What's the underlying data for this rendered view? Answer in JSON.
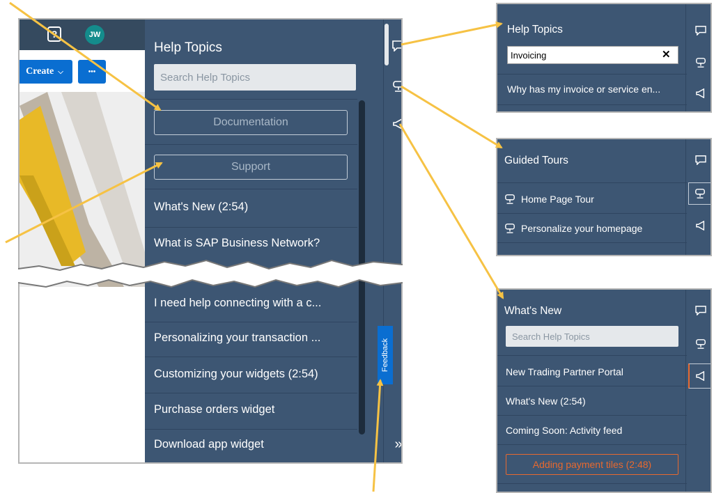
{
  "header": {
    "avatar_initials": "JW",
    "help_icon": "question-icon"
  },
  "actions": {
    "create_label": "Create",
    "more_label": "•••"
  },
  "help_panel": {
    "title": "Help Topics",
    "search_placeholder": "Search Help Topics",
    "documentation_label": "Documentation",
    "support_label": "Support",
    "items_top": [
      "What's New (2:54)",
      "What is SAP Business Network?"
    ],
    "items_bottom": [
      "I need help connecting with a c...",
      "Personalizing your transaction ...",
      "Customizing your widgets (2:54)",
      "Purchase orders widget",
      "Download app widget"
    ],
    "feedback_label": "Feedback",
    "collapse_icon": "»"
  },
  "help_topics_panel": {
    "title": "Help Topics",
    "search_value": "Invoicing",
    "clear_icon": "✕",
    "result": "Why has my invoice or service en..."
  },
  "guided_tours_panel": {
    "title": "Guided Tours",
    "items": [
      "Home Page Tour",
      "Personalize your homepage"
    ]
  },
  "whats_new_panel": {
    "title": "What's New",
    "search_placeholder": "Search Help Topics",
    "items": [
      "New Trading Partner Portal",
      "What's New (2:54)",
      "Coming Soon: Activity feed"
    ],
    "highlighted_item": "Adding payment tiles (2:48)"
  },
  "colors": {
    "panel_bg": "#3d5673",
    "shell_bar": "#354a5f",
    "accent_blue": "#0a6ed1",
    "callout_yellow": "#f6c244",
    "highlight_orange": "#e8692f",
    "avatar_teal": "#148c8c"
  }
}
